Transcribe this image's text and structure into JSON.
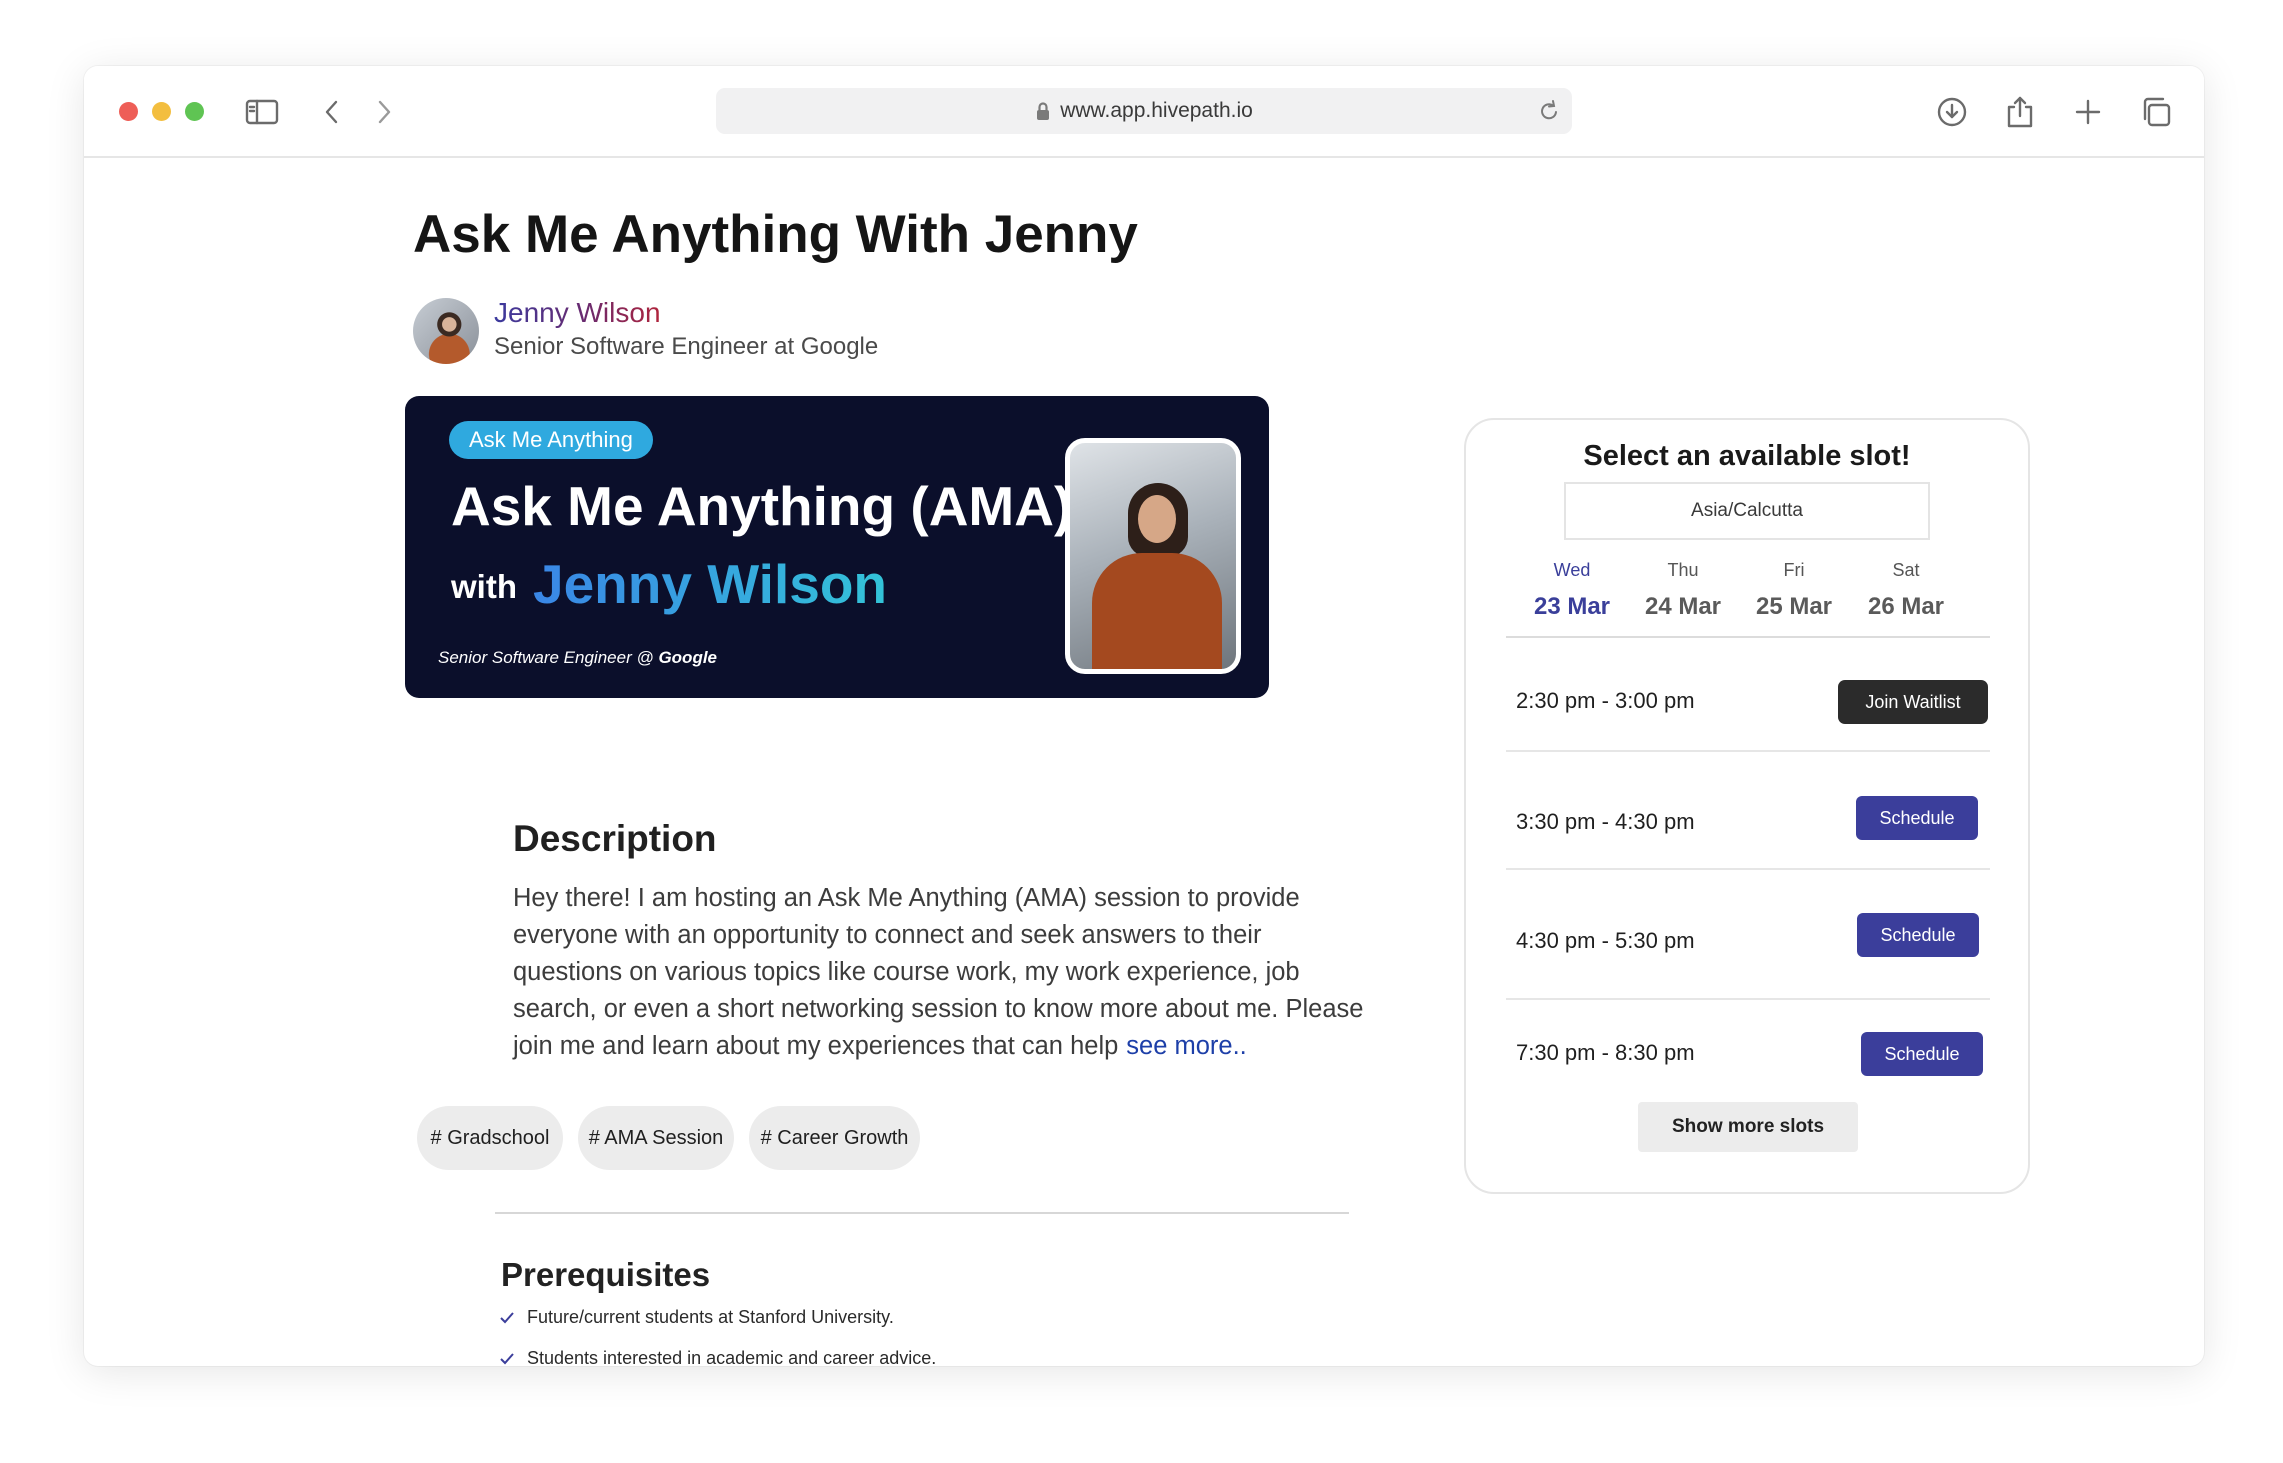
{
  "browser": {
    "url": "www.app.hivepath.io"
  },
  "page": {
    "title": "Ask Me Anything With Jenny"
  },
  "host": {
    "name": "Jenny Wilson",
    "role": "Senior Software Engineer at Google"
  },
  "banner": {
    "tag": "Ask Me Anything",
    "heading": "Ask Me Anything (AMA)",
    "with": "with",
    "name": "Jenny Wilson",
    "role_prefix": "Senior Software Engineer @",
    "role_company": "Google"
  },
  "description": {
    "title": "Description",
    "text": "Hey there! I am hosting an Ask Me Anything (AMA) session to provide everyone with an opportunity to connect and seek answers to their questions on various topics like course work, my work experience, job search, or even a short networking session to know more about me. Please join me and learn about my experiences that can help",
    "see_more": "see more.."
  },
  "tags": [
    "# Gradschool",
    "# AMA Session",
    "# Career Growth"
  ],
  "prerequisites": {
    "title": "Prerequisites",
    "items": [
      "Future/current students at Stanford University.",
      "Students interested in academic and career advice."
    ]
  },
  "slots": {
    "title": "Select an available slot!",
    "timezone": "Asia/Calcutta",
    "days": [
      {
        "name": "Wed",
        "date": "23 Mar",
        "active": true
      },
      {
        "name": "Thu",
        "date": "24 Mar",
        "active": false
      },
      {
        "name": "Fri",
        "date": "25 Mar",
        "active": false
      },
      {
        "name": "Sat",
        "date": "26 Mar",
        "active": false
      }
    ],
    "items": [
      {
        "time": "2:30 pm - 3:00 pm",
        "action": "Join Waitlist"
      },
      {
        "time": "3:30 pm - 4:30 pm",
        "action": "Schedule"
      },
      {
        "time": "4:30 pm - 5:30 pm",
        "action": "Schedule"
      },
      {
        "time": "7:30 pm - 8:30 pm",
        "action": "Schedule"
      }
    ],
    "show_more": "Show more slots"
  },
  "colors": {
    "accent": "#3b3e9b",
    "banner_bg": "#0b0f2b",
    "banner_tag": "#2fa9df",
    "link": "#1d3fa8"
  }
}
